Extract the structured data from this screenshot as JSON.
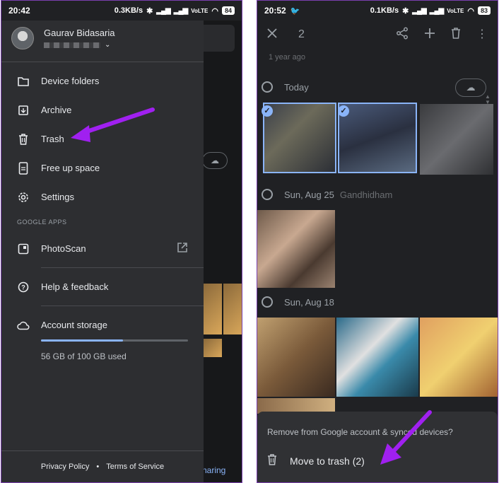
{
  "left": {
    "status": {
      "time": "20:42",
      "speed": "0.3KB/s",
      "battery": "84"
    },
    "account": {
      "name": "Gaurav Bidasaria"
    },
    "menu": [
      {
        "label": "Device folders",
        "icon": "folder-icon"
      },
      {
        "label": "Archive",
        "icon": "archive-icon"
      },
      {
        "label": "Trash",
        "icon": "trash-icon"
      },
      {
        "label": "Free up space",
        "icon": "phone-clean-icon"
      },
      {
        "label": "Settings",
        "icon": "gear-icon"
      }
    ],
    "google_apps_label": "GOOGLE APPS",
    "photoscan": {
      "label": "PhotoScan",
      "icon": "photoscan-icon",
      "trail_icon": "open-external-icon"
    },
    "help": {
      "label": "Help & feedback",
      "icon": "help-icon"
    },
    "storage": {
      "label": "Account storage",
      "icon": "cloud-icon",
      "used_text": "56 GB of 100 GB used",
      "used_fraction": 0.56
    },
    "footer": {
      "privacy": "Privacy Policy",
      "sep": "•",
      "terms": "Terms of Service"
    },
    "bg_sharing_label": "naring",
    "arrow_color": "#a020f0"
  },
  "right": {
    "status": {
      "time": "20:52",
      "speed": "0.1KB/s",
      "battery": "83"
    },
    "selected_count": "2",
    "ago": "1 year ago",
    "groups": [
      {
        "date": "Today",
        "location": ""
      },
      {
        "date": "Sun, Aug 25",
        "location": "Gandhidham"
      },
      {
        "date": "Sun, Aug 18",
        "location": ""
      }
    ],
    "sheet": {
      "title": "Remove from Google account & synced devices?",
      "action": "Move to trash (2)"
    },
    "arrow_color": "#a020f0"
  }
}
